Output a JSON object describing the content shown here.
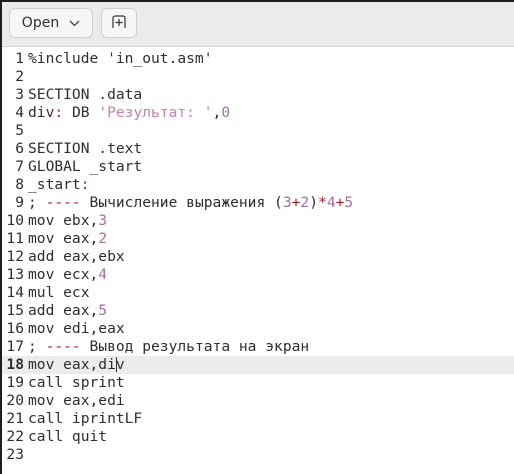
{
  "header": {
    "open_label": "Open",
    "open_icon": "chevron-down-icon",
    "new_tab_icon": "new-tab-icon"
  },
  "editor": {
    "current_line": 18,
    "caret": {
      "line": 18,
      "col": 14
    },
    "lines": [
      [
        {
          "t": "%include 'in_out.asm'",
          "c": "n"
        }
      ],
      [],
      [
        {
          "t": "SECTION .data",
          "c": "n"
        }
      ],
      [
        {
          "t": "div",
          "c": "n"
        },
        {
          "t": ":",
          "c": "r"
        },
        {
          "t": " DB ",
          "c": "n"
        },
        {
          "t": "'Результат: '",
          "c": "s"
        },
        {
          "t": ",",
          "c": "n"
        },
        {
          "t": "0",
          "c": "p"
        }
      ],
      [],
      [
        {
          "t": "SECTION .text",
          "c": "n"
        }
      ],
      [
        {
          "t": "GLOBAL _start",
          "c": "n"
        }
      ],
      [
        {
          "t": "_start",
          "c": "n"
        },
        {
          "t": ":",
          "c": "r"
        }
      ],
      [
        {
          "t": "; ",
          "c": "n"
        },
        {
          "t": "----",
          "c": "r"
        },
        {
          "t": " Вычисление выражения (",
          "c": "n"
        },
        {
          "t": "3",
          "c": "p"
        },
        {
          "t": "+",
          "c": "r"
        },
        {
          "t": "2",
          "c": "p"
        },
        {
          "t": ")",
          "c": "n"
        },
        {
          "t": "*",
          "c": "r"
        },
        {
          "t": "4",
          "c": "p"
        },
        {
          "t": "+",
          "c": "r"
        },
        {
          "t": "5",
          "c": "p"
        }
      ],
      [
        {
          "t": "mov ebx,",
          "c": "n"
        },
        {
          "t": "3",
          "c": "p"
        }
      ],
      [
        {
          "t": "mov eax,",
          "c": "n"
        },
        {
          "t": "2",
          "c": "p"
        }
      ],
      [
        {
          "t": "add eax,ebx",
          "c": "n"
        }
      ],
      [
        {
          "t": "mov ecx,",
          "c": "n"
        },
        {
          "t": "4",
          "c": "p"
        }
      ],
      [
        {
          "t": "mul ecx",
          "c": "n"
        }
      ],
      [
        {
          "t": "add eax,",
          "c": "n"
        },
        {
          "t": "5",
          "c": "p"
        }
      ],
      [
        {
          "t": "mov edi,eax",
          "c": "n"
        }
      ],
      [
        {
          "t": "; ",
          "c": "n"
        },
        {
          "t": "----",
          "c": "r"
        },
        {
          "t": " Вывод результата на экран",
          "c": "n"
        }
      ],
      [
        {
          "t": "mov eax,di",
          "c": "n"
        },
        {
          "t": "|",
          "c": "caret"
        },
        {
          "t": "v",
          "c": "n"
        }
      ],
      [
        {
          "t": "call sprint",
          "c": "n"
        }
      ],
      [
        {
          "t": "mov eax,edi",
          "c": "n"
        }
      ],
      [
        {
          "t": "call iprintLF",
          "c": "n"
        }
      ],
      [
        {
          "t": "call quit",
          "c": "n"
        }
      ],
      []
    ]
  }
}
